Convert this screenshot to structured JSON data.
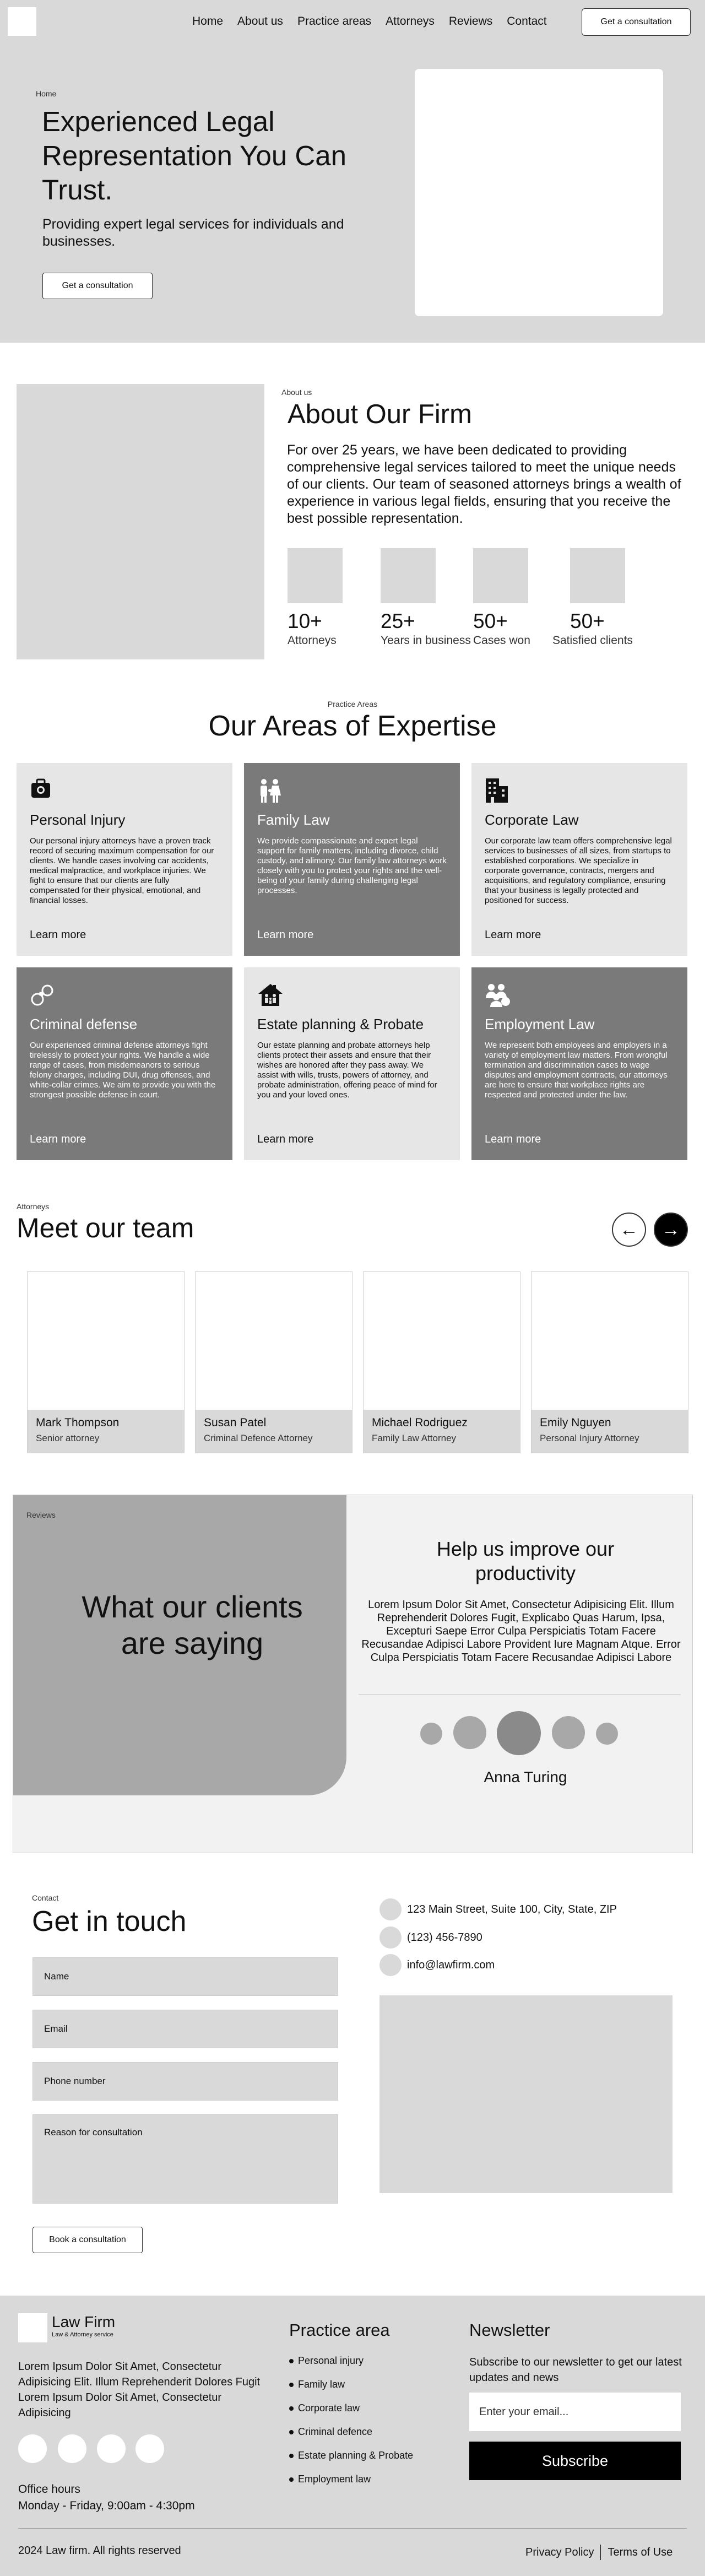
{
  "nav": {
    "links": [
      "Home",
      "About us",
      "Practice areas",
      "Attorneys",
      "Reviews",
      "Contact"
    ],
    "cta": "Get a consultation"
  },
  "hero": {
    "breadcrumb": "Home",
    "title": "Experienced Legal Representation You Can Trust.",
    "subtitle": "Providing expert legal services for individuals and businesses.",
    "cta": "Get a consultation"
  },
  "about": {
    "label": "About us",
    "title": "About Our Firm",
    "body": "For over 25 years, we have been dedicated to providing comprehensive legal services tailored to meet the unique needs of our clients. Our team of seasoned attorneys brings a wealth of experience in various legal fields, ensuring that you receive the best possible representation.",
    "stats": [
      {
        "value": "10+",
        "label": "Attorneys"
      },
      {
        "value": "25+",
        "label": "Years in business"
      },
      {
        "value": "50+",
        "label": "Cases won"
      },
      {
        "value": "50+",
        "label": "Satisfied clients"
      }
    ]
  },
  "expertise": {
    "label": "Practice Areas",
    "title": "Our Areas of Expertise",
    "cards": [
      {
        "icon": "briefcase-icon",
        "title": "Personal Injury",
        "text": "Our personal injury attorneys have a proven track record of securing maximum compensation for our clients. We handle cases involving car accidents, medical malpractice, and workplace injuries. We fight to ensure that our clients are fully compensated for their physical, emotional, and financial losses.",
        "more": "Learn more"
      },
      {
        "icon": "family-icon",
        "title": "Family Law",
        "text": "We provide compassionate and expert legal support for family matters, including divorce, child custody, and alimony. Our family law attorneys work closely with you to protect your rights and the well-being of your family during challenging legal processes.",
        "more": "Learn more"
      },
      {
        "icon": "building-icon",
        "title": "Corporate Law",
        "text": "Our corporate law team offers comprehensive legal services to businesses of all sizes, from startups to established corporations. We specialize in corporate governance, contracts, mergers and acquisitions, and regulatory compliance, ensuring that your business is legally protected and positioned for success.",
        "more": "Learn more"
      },
      {
        "icon": "handcuffs-icon",
        "title": "Criminal defense",
        "text": "Our experienced criminal defense attorneys fight tirelessly to protect your rights. We handle a wide range of cases, from misdemeanors to serious felony charges, including DUI, drug offenses, and white-collar crimes. We aim to provide you with the strongest possible defense in court.",
        "more": "Learn more"
      },
      {
        "icon": "house-family-icon",
        "title": "Estate planning & Probate",
        "text": "Our estate planning and probate attorneys help clients protect their assets and ensure that their wishes are honored after they pass away. We assist with wills, trusts, powers of attorney, and probate administration, offering peace of mind for you and your loved ones.",
        "more": "Learn more"
      },
      {
        "icon": "group-icon",
        "title": "Employment Law",
        "text": "We represent both employees and employers in a variety of employment law matters. From wrongful termination and discrimination cases to wage disputes and employment contracts, our attorneys are here to ensure that workplace rights are respected and protected under the law.",
        "more": "Learn more"
      }
    ]
  },
  "team": {
    "label": "Attorneys",
    "title": "Meet our team",
    "members": [
      {
        "name": "Mark Thompson",
        "role": "Senior attorney"
      },
      {
        "name": "Susan Patel",
        "role": "Criminal Defence Attorney"
      },
      {
        "name": "Michael Rodriguez",
        "role": "Family Law Attorney"
      },
      {
        "name": "Emily Nguyen",
        "role": "Personal Injury Attorney"
      }
    ]
  },
  "reviews": {
    "label": "Reviews",
    "headline": "What our clients are saying",
    "heading": "Help us improve our productivity",
    "text": "Lorem Ipsum Dolor Sit Amet, Consectetur Adipisicing Elit. Illum Reprehenderit Dolores Fugit, Explicabo Quas Harum, Ipsa, Excepturi Saepe Error Culpa Perspiciatis Totam Facere Recusandae Adipisci Labore Provident Iure Magnam Atque. Error Culpa Perspiciatis Totam Facere Recusandae Adipisci Labore",
    "reviewer": "Anna Turing"
  },
  "contact": {
    "label": "Contact",
    "title": "Get in touch",
    "fields": [
      "Name",
      "Email",
      "Phone number",
      "Reason for consultation"
    ],
    "cta": "Book a consultation",
    "address": "123 Main Street, Suite 100, City, State, ZIP",
    "phone": "(123) 456-7890",
    "email": "info@lawfirm.com"
  },
  "footer": {
    "name": "Law Firm",
    "tagline": "Law & Attorney service",
    "description": "Lorem Ipsum Dolor Sit Amet, Consectetur Adipisicing Elit. Illum Reprehenderit Dolores Fugit Lorem Ipsum Dolor Sit Amet, Consectetur Adipisicing",
    "office_hours_label": "Office hours",
    "office_hours": "Monday - Friday, 9:00am - 4:30pm",
    "practice_title": "Practice area",
    "practice_items": [
      "Personal injury",
      "Family law",
      "Corporate law",
      "Criminal defence",
      "Estate planning & Probate",
      "Employment law"
    ],
    "newsletter_title": "Newsletter",
    "newsletter_text": "Subscribe to our newsletter to get our latest updates and news",
    "email_placeholder": "Enter your email...",
    "subscribe": "Subscribe",
    "copyright": "2024 Law firm. All rights reserved",
    "privacy": "Privacy Policy",
    "terms": "Terms of Use"
  }
}
